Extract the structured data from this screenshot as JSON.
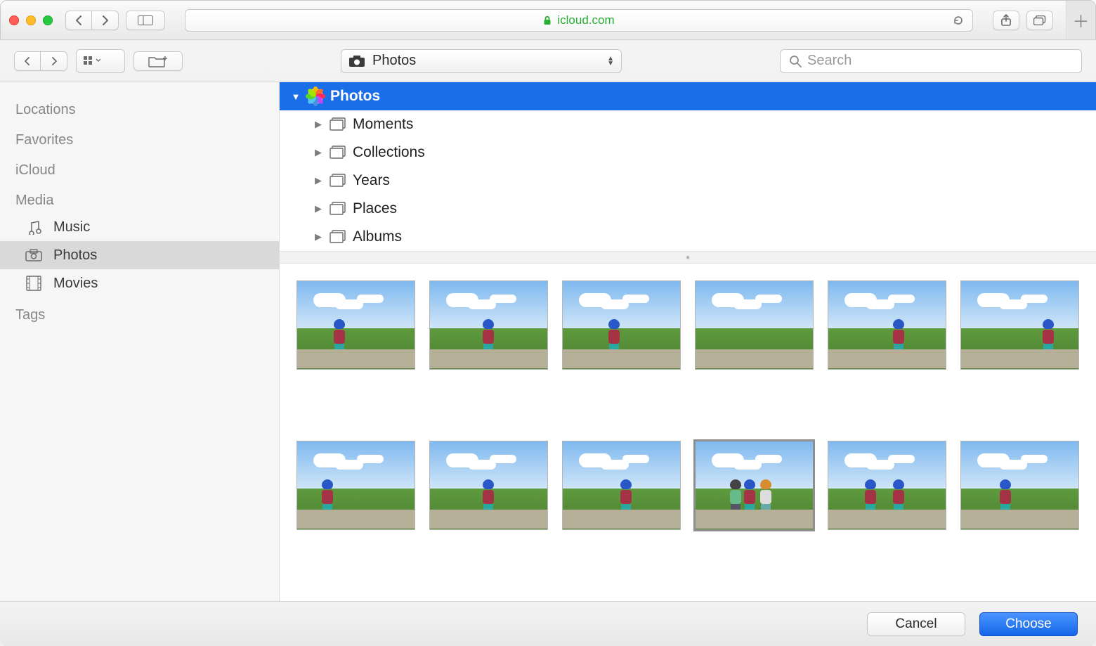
{
  "browser": {
    "url_host": "icloud.com"
  },
  "sheet": {
    "location_popup": "Photos",
    "search_placeholder": "Search"
  },
  "sidebar": {
    "sections": [
      "Locations",
      "Favorites",
      "iCloud",
      "Media",
      "Tags"
    ],
    "media_items": [
      {
        "icon": "music-icon",
        "label": "Music"
      },
      {
        "icon": "photos-icon",
        "label": "Photos",
        "selected": true
      },
      {
        "icon": "movies-icon",
        "label": "Movies"
      }
    ]
  },
  "tree": {
    "root": "Photos",
    "children": [
      "Moments",
      "Collections",
      "Years",
      "Places",
      "Albums"
    ]
  },
  "thumbnails": {
    "count": 12,
    "selected_index": 9
  },
  "footer": {
    "cancel": "Cancel",
    "choose": "Choose"
  }
}
